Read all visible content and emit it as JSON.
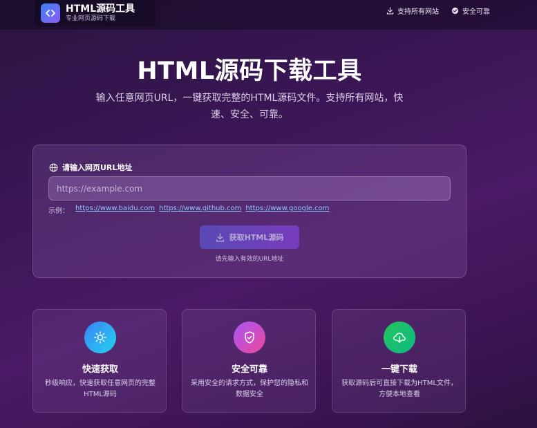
{
  "header": {
    "brand_title": "HTML源码工具",
    "brand_subtitle": "专业网页源码下载",
    "nav": [
      {
        "label": "支持所有网站",
        "icon": "download-icon"
      },
      {
        "label": "安全可靠",
        "icon": "check-circle-icon"
      }
    ]
  },
  "hero": {
    "title": "HTML源码下载工具",
    "description": "输入任意网页URL，一键获取完整的HTML源码文件。支持所有网站，快速、安全、可靠。"
  },
  "form": {
    "label": "请输入网页URL地址",
    "placeholder": "https://example.com",
    "value": "",
    "examples_label": "示例：",
    "examples": [
      "https://www.baidu.com",
      "https://www.github.com",
      "https://www.google.com"
    ],
    "button_label": "获取HTML源码",
    "hint": "请先输入有效的URL地址"
  },
  "features": [
    {
      "title": "快速获取",
      "desc": "秒级响应，快速获取任意网页的完整HTML源码",
      "icon": "sun-icon",
      "color_from": "#3b82f6",
      "color_to": "#22d3ee"
    },
    {
      "title": "安全可靠",
      "desc": "采用安全的请求方式，保护您的隐私和数据安全",
      "icon": "shield-check-icon",
      "color_from": "#a855f7",
      "color_to": "#ec4899"
    },
    {
      "title": "一键下载",
      "desc": "获取源码后可直接下载为HTML文件，方便本地查看",
      "icon": "cloud-download-icon",
      "color_from": "#22c55e",
      "color_to": "#10b981"
    }
  ]
}
